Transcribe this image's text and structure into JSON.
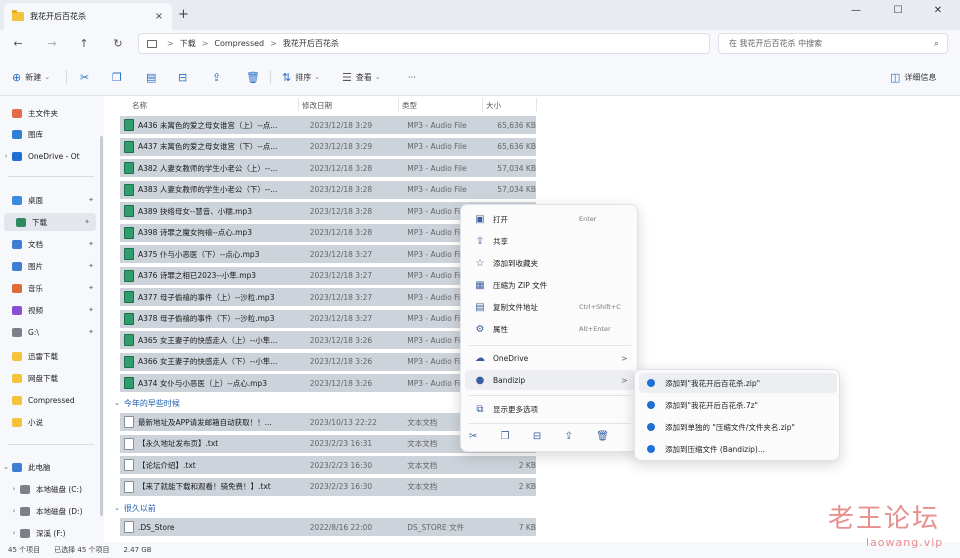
{
  "tab": {
    "title": "我花开后百花杀",
    "close": "×",
    "new_tab": "+"
  },
  "window": {
    "minimize": "—",
    "maximize": "☐",
    "close": "✕"
  },
  "address": {
    "crumbs": [
      "下载",
      "Compressed",
      "我花开后百花杀"
    ],
    "sep": ">",
    "search_placeholder": "在 我花开后百花杀 中搜索"
  },
  "toolbar": {
    "new_label": "新建",
    "sort_label": "排序",
    "view_label": "查看",
    "more": "···",
    "details_label": "详细信息"
  },
  "sidebar": {
    "items": [
      {
        "label": "主文件夹",
        "color": "#e36b4b"
      },
      {
        "label": "图库",
        "color": "#2f7fd8"
      },
      {
        "label": "OneDrive - Ot",
        "color": "#1f6fd4"
      },
      {
        "label": "桌面",
        "color": "#3d8be0"
      },
      {
        "label": "下载",
        "color": "#2d8a5f"
      },
      {
        "label": "文档",
        "color": "#3d7fd0"
      },
      {
        "label": "图片",
        "color": "#3d7fd0"
      },
      {
        "label": "音乐",
        "color": "#e06a3a"
      },
      {
        "label": "视频",
        "color": "#8a4fd6"
      },
      {
        "label": "G:\\",
        "color": "#7c8088"
      },
      {
        "label": "迅雷下载",
        "color": "#f3c33c"
      },
      {
        "label": "网盘下载",
        "color": "#f3c33c"
      },
      {
        "label": "Compressed",
        "color": "#f3c33c"
      },
      {
        "label": "小说",
        "color": "#f3c33c"
      },
      {
        "label": "此电脑",
        "color": "#3d7fd0"
      },
      {
        "label": "本地磁盘 (C:)",
        "color": "#7c8088"
      },
      {
        "label": "本地磁盘 (D:)",
        "color": "#7c8088"
      },
      {
        "label": "深溪 (F:)",
        "color": "#7c8088"
      }
    ],
    "pin": "📌"
  },
  "columns": {
    "name": "名称",
    "date": "修改日期",
    "type": "类型",
    "size": "大小"
  },
  "files_mp3": [
    {
      "name": "A436 未寓色的爱之母女谁宫（上）--点...",
      "date": "2023/12/18 3:29",
      "type": "MP3 - Audio File",
      "size": "65,636 KB"
    },
    {
      "name": "A437 末寓色的爱之母女谁宫（下）--点...",
      "date": "2023/12/18 3:29",
      "type": "MP3 - Audio File",
      "size": "65,636 KB"
    },
    {
      "name": "A382 人妻女教师的学生小老公（上）--...",
      "date": "2023/12/18 3:28",
      "type": "MP3 - Audio File",
      "size": "57,034 KB"
    },
    {
      "name": "A383 人妻女教师的学生小老公（下）--...",
      "date": "2023/12/18 3:28",
      "type": "MP3 - Audio File",
      "size": "57,034 KB"
    },
    {
      "name": "A389 抉络母女--慧音、小糯.mp3",
      "date": "2023/12/18 3:28",
      "type": "MP3 - Audio File",
      "size": ""
    },
    {
      "name": "A398 诗罪之魔女拘禧--点心.mp3",
      "date": "2023/12/18 3:28",
      "type": "MP3 - Audio File",
      "size": ""
    },
    {
      "name": "A375 仆与小恶医（下）--点心.mp3",
      "date": "2023/12/18 3:27",
      "type": "MP3 - Audio File",
      "size": ""
    },
    {
      "name": "A376 诗罪之相已2023--小隼.mp3",
      "date": "2023/12/18 3:27",
      "type": "MP3 - Audio File",
      "size": ""
    },
    {
      "name": "A377 母子偷禧的事件（上）--沙粒.mp3",
      "date": "2023/12/18 3:27",
      "type": "MP3 - Audio File",
      "size": ""
    },
    {
      "name": "A378 母子偷禧的事件（下）--沙粒.mp3",
      "date": "2023/12/18 3:27",
      "type": "MP3 - Audio File",
      "size": ""
    },
    {
      "name": "A365 女王妻子的快感走人（上）--小隼...",
      "date": "2023/12/18 3:26",
      "type": "MP3 - Audio File",
      "size": ""
    },
    {
      "name": "A366 女王妻子的快感走人（下）--小隼...",
      "date": "2023/12/18 3:26",
      "type": "MP3 - Audio File",
      "size": ""
    },
    {
      "name": "A374 女仆与小恶医（上）--点心.mp3",
      "date": "2023/12/18 3:26",
      "type": "MP3 - Audio File",
      "size": ""
    }
  ],
  "group_year": "今年的早些时候",
  "files_year": [
    {
      "name": "最新地址及APP请发邮箱自动获取！！...",
      "date": "2023/10/13 22:22",
      "type": "文本文档",
      "size": ""
    },
    {
      "name": "【永久地址发布页】.txt",
      "date": "2023/2/23 16:31",
      "type": "文本文档",
      "size": ""
    },
    {
      "name": "【论坛介绍】.txt",
      "date": "2023/2/23 16:30",
      "type": "文本文档",
      "size": "2 KB"
    },
    {
      "name": "【来了就能下载和观看！骑免费！】.txt",
      "date": "2023/2/23 16:30",
      "type": "文本文档",
      "size": "2 KB"
    }
  ],
  "group_old": "很久以前",
  "files_old": [
    {
      "name": ".DS_Store",
      "date": "2022/8/16 22:00",
      "type": "DS_STORE 文件",
      "size": "7 KB"
    }
  ],
  "context_menu": {
    "open": {
      "label": "打开",
      "shortcut": "Enter"
    },
    "share": {
      "label": "共享"
    },
    "favorite": {
      "label": "添加到收藏夹"
    },
    "zip": {
      "label": "压缩为 ZIP 文件"
    },
    "copy_path": {
      "label": "复制文件地址",
      "shortcut": "Ctrl+Shift+C"
    },
    "properties": {
      "label": "属性",
      "shortcut": "Alt+Enter"
    },
    "onedrive": {
      "label": "OneDrive",
      "arrow": ">"
    },
    "bandizip": {
      "label": "Bandizip",
      "arrow": ">"
    },
    "more_options": {
      "label": "显示更多选项"
    }
  },
  "submenu": [
    "添加到\"我花开后百花杀.zip\"",
    "添加到\"我花开后百花杀.7z\"",
    "添加到单独的 \"压缩文件/文件夹名.zip\"",
    "添加到压缩文件 (Bandizip)..."
  ],
  "status": {
    "count": "45 个项目",
    "selected": "已选择 45 个项目",
    "size": "2.47 GB"
  },
  "watermark": {
    "title": "老王论坛",
    "url": "laowang.vip"
  }
}
